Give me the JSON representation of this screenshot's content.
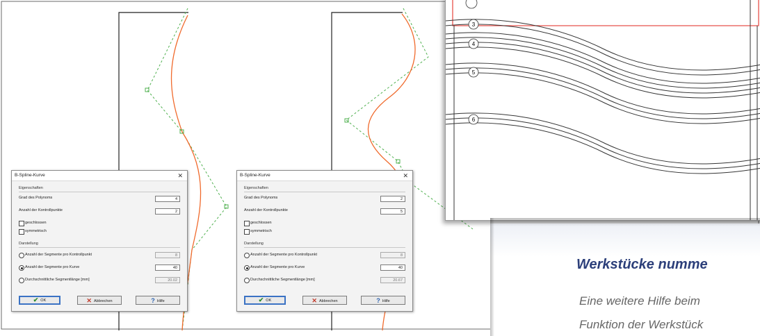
{
  "dialog_left": {
    "title": "B-Spline-Kurve",
    "close": "✕",
    "props_title": "Eigenschaften",
    "grad_label": "Grad des Polynoms",
    "grad_value": "4",
    "anzahl_label": "Anzahl der Kontrollpunkte",
    "anzahl_value": "2",
    "geschlossen_label": "geschlossen",
    "symmetrisch_label": "symmetrisch",
    "darstellung_title": "Darstellung",
    "opt1_label": "Anzahl der Segmente pro Kontrollpunkt",
    "opt1_value": "8",
    "opt2_label": "Anzahl der Segmente pro Kurve",
    "opt2_value": "40",
    "opt3_label": "Durchschnittliche Segmentlänge [mm]",
    "opt3_value": "20.02",
    "ok_label": "OK",
    "cancel_label": "Abbrechen",
    "help_label": "Hilfe"
  },
  "dialog_right": {
    "title": "B-Spline-Kurve",
    "close": "✕",
    "props_title": "Eigenschaften",
    "grad_label": "Grad des Polynoms",
    "grad_value": "2",
    "anzahl_label": "Anzahl der Kontrollpunkte",
    "anzahl_value": "5",
    "geschlossen_label": "geschlossen",
    "symmetrisch_label": "symmetrisch",
    "darstellung_title": "Darstellung",
    "opt1_label": "Anzahl der Segmente pro Kontrollpunkt",
    "opt1_value": "8",
    "opt2_label": "Anzahl der Segmente pro Kurve",
    "opt2_value": "40",
    "opt3_label": "Durchschnittliche Segmentlänge [mm]",
    "opt3_value": "20.67",
    "ok_label": "OK",
    "cancel_label": "Abbrechen",
    "help_label": "Hilfe"
  },
  "workpiece_numbers": [
    "3",
    "4",
    "5",
    "6"
  ],
  "article": {
    "heading": "Werkstücke numme",
    "line1": "Eine weitere Hilfe beim",
    "line2": "Funktion der Werkstück"
  },
  "colors": {
    "curve": "#f06a2c",
    "control_polygon": "#4fb04f",
    "heading": "#2c3f7a",
    "red_frame": "#e8504a"
  }
}
